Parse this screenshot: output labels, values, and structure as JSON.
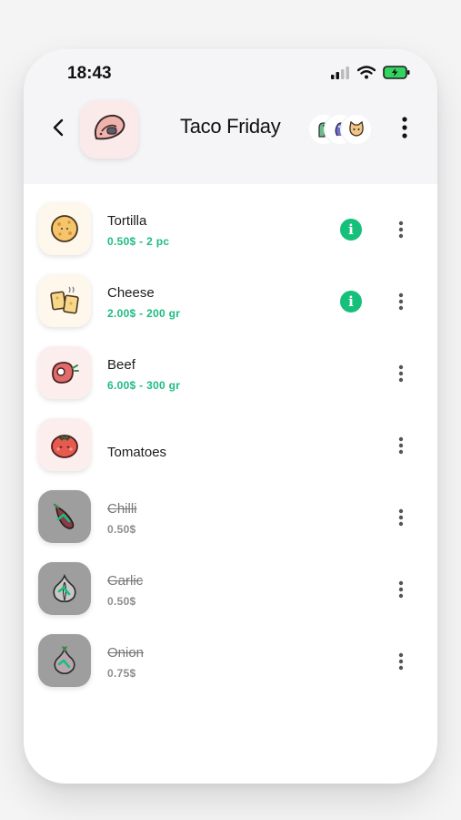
{
  "status": {
    "time": "18:43"
  },
  "header": {
    "title": "Taco Friday"
  },
  "items": [
    {
      "name": "Tortilla",
      "price": "0.50$ - 2 pc",
      "info": true,
      "done": false,
      "icon": "tortilla-icon",
      "bg": "#fdf7ec"
    },
    {
      "name": "Cheese",
      "price": "2.00$ - 200 gr",
      "info": true,
      "done": false,
      "icon": "cheese-icon",
      "bg": "#fdf7ec"
    },
    {
      "name": "Beef",
      "price": "6.00$ - 300 gr",
      "info": false,
      "done": false,
      "icon": "steak-icon",
      "bg": "#fdeeee"
    },
    {
      "name": "Tomatoes",
      "price": "",
      "info": false,
      "done": false,
      "icon": "tomato-icon",
      "bg": "#fdeeee"
    },
    {
      "name": "Chilli",
      "price": "0.50$",
      "info": false,
      "done": true,
      "icon": "chilli-icon",
      "bg": "#9e9e9e"
    },
    {
      "name": "Garlic",
      "price": "0.50$",
      "info": false,
      "done": true,
      "icon": "garlic-icon",
      "bg": "#9e9e9e"
    },
    {
      "name": "Onion",
      "price": "0.75$",
      "info": false,
      "done": true,
      "icon": "onion-icon",
      "bg": "#9e9e9e"
    }
  ],
  "colors": {
    "accent": "#16c07a",
    "price": "#1dbd82",
    "done": "#8c8c8c"
  }
}
